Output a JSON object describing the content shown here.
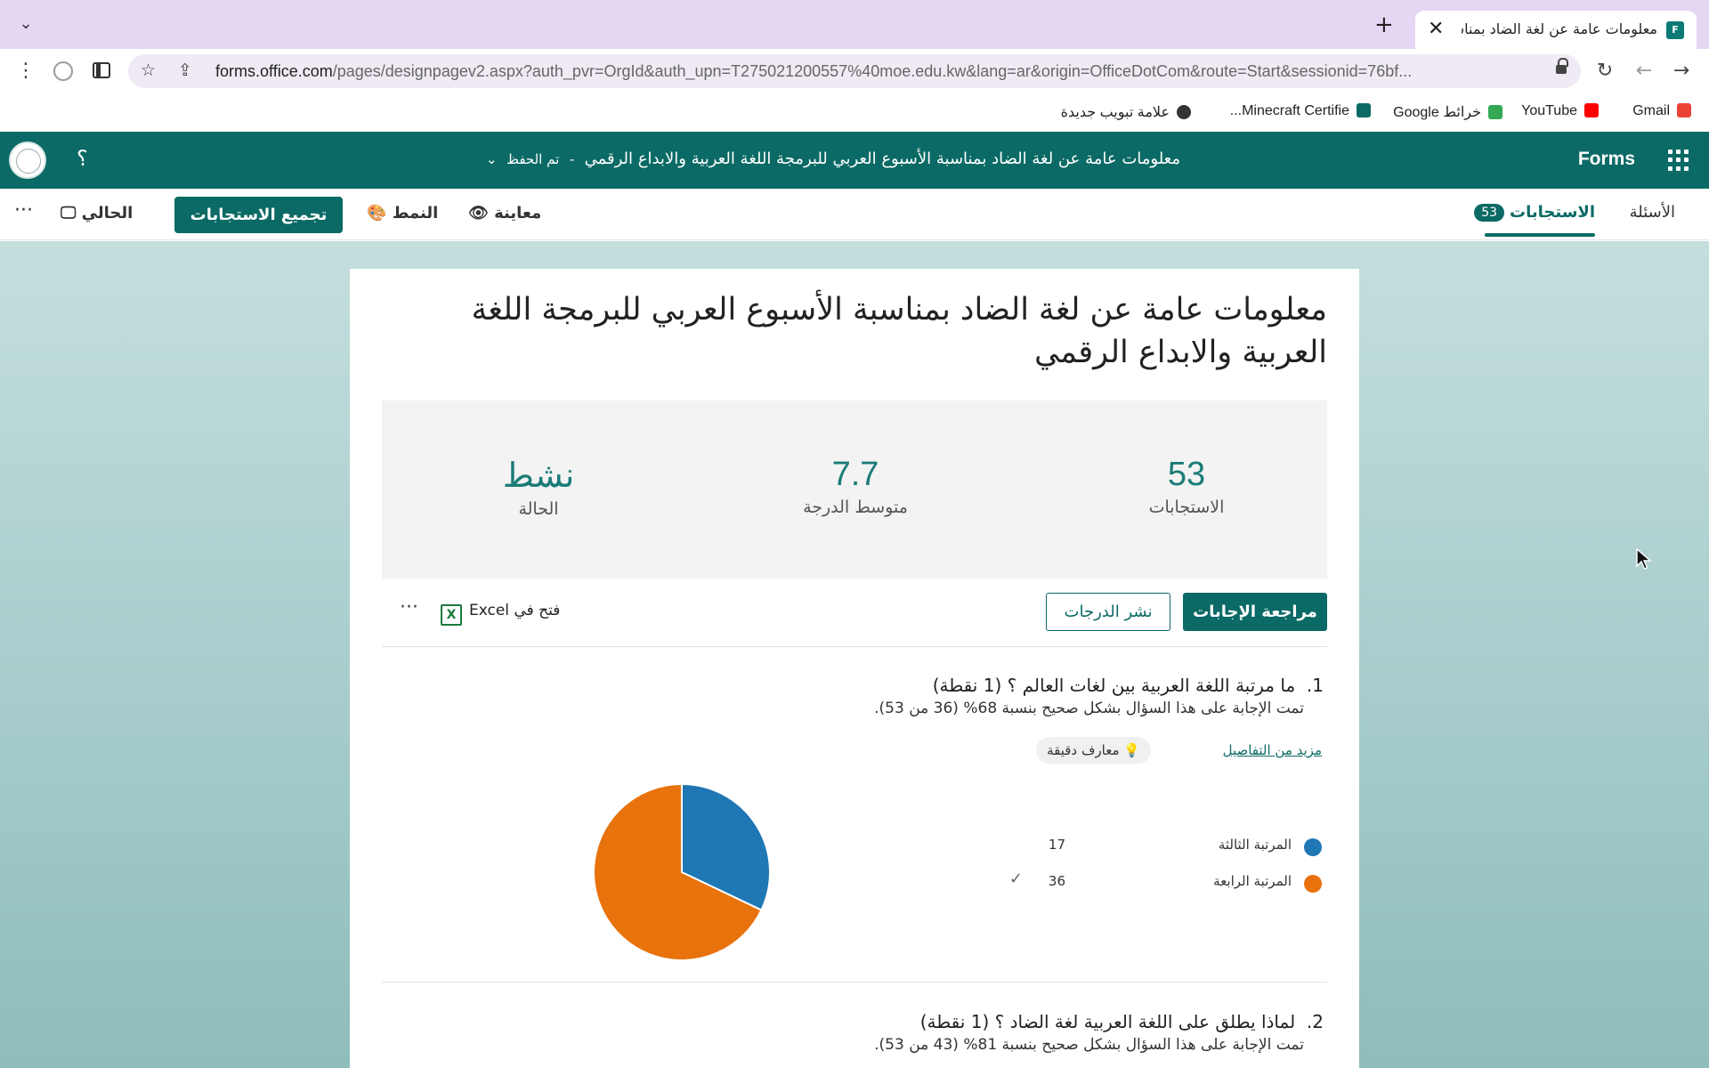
{
  "browser": {
    "tab": {
      "title": "معلومات عامة عن لغة الضاد  بمناسبة",
      "favicon_label": "F",
      "close_glyph": "✕"
    },
    "new_tab_glyph": "+",
    "tab_list_glyph": "⌄",
    "url_host": "forms.office.com",
    "url_path": "/pages/designpagev2.aspx?auth_pvr=OrgId&auth_upn=T275021200557%40moe.edu.kw&lang=ar&origin=OfficeDotCom&route=Start&sessionid=76bf...",
    "bookmarks": [
      {
        "label": "Gmail",
        "color": "#ea4335"
      },
      {
        "label": "YouTube",
        "color": "#ff0000"
      },
      {
        "label": "خرائط Google",
        "color": "#34a853"
      },
      {
        "label": "Minecraft Certifie...",
        "color": "#0b6a65"
      },
      {
        "label": "علامة تبويب جديدة",
        "color": "#333333"
      }
    ]
  },
  "app": {
    "name": "Forms",
    "doc_title": "معلومات عامة عن لغة الضاد  بمناسبة الأسبوع العربي للبرمجة اللغة العربية والابداع الرقمي",
    "saved_status": "تم الحفظ",
    "separator": "-",
    "help_glyph": "؟"
  },
  "cmdbar": {
    "tab_questions": "الأسئلة",
    "tab_responses": "الاستجابات",
    "responses_count": "53",
    "preview": "معاينة",
    "style": "النمط",
    "collect": "تجميع الاستجابات",
    "present": "الحالي",
    "more": "···"
  },
  "form": {
    "title": "معلومات عامة عن لغة الضاد  بمناسبة الأسبوع العربي للبرمجة اللغة العربية والابداع الرقمي",
    "stats": [
      {
        "value": "53",
        "label": "الاستجابات"
      },
      {
        "value": "7.7",
        "label": "متوسط الدرجة"
      },
      {
        "value": "نشط",
        "label": "الحالة"
      }
    ],
    "review_label": "مراجعة الإجابات",
    "publish_label": "نشر الدرجات",
    "excel_label": "فتح في Excel",
    "excel_icon": "X",
    "more_label": "···"
  },
  "questions": [
    {
      "number": "1.",
      "title": "ما مرتبة اللغة العربية بين لغات العالم  ؟ (1 نقطة)",
      "summary": "تمت الإجابة على هذا السؤال بشكل صحيح بنسبة 68% (36 من 53).",
      "details_link": "مزيد من التفاصيل",
      "insights_chip": "معارف دقيقة",
      "options": [
        {
          "label": "المرتبة الثالثة",
          "count": "17",
          "color": "#1f77b4",
          "correct": false
        },
        {
          "label": "المرتبة الرابعة",
          "count": "36",
          "color": "#e8720c",
          "correct": true
        }
      ],
      "check_glyph": "✓"
    },
    {
      "number": "2.",
      "title": "لماذا يطلق على اللغة العربية لغة الضاد ؟ (1 نقطة)",
      "summary": "تمت الإجابة على هذا السؤال بشكل صحيح بنسبة 81% (43 من 53)."
    }
  ],
  "chart_data": {
    "type": "pie",
    "categories": [
      "المرتبة الثالثة",
      "المرتبة الرابعة"
    ],
    "values": [
      17,
      36
    ],
    "colors": [
      "#1f77b4",
      "#e8720c"
    ]
  }
}
